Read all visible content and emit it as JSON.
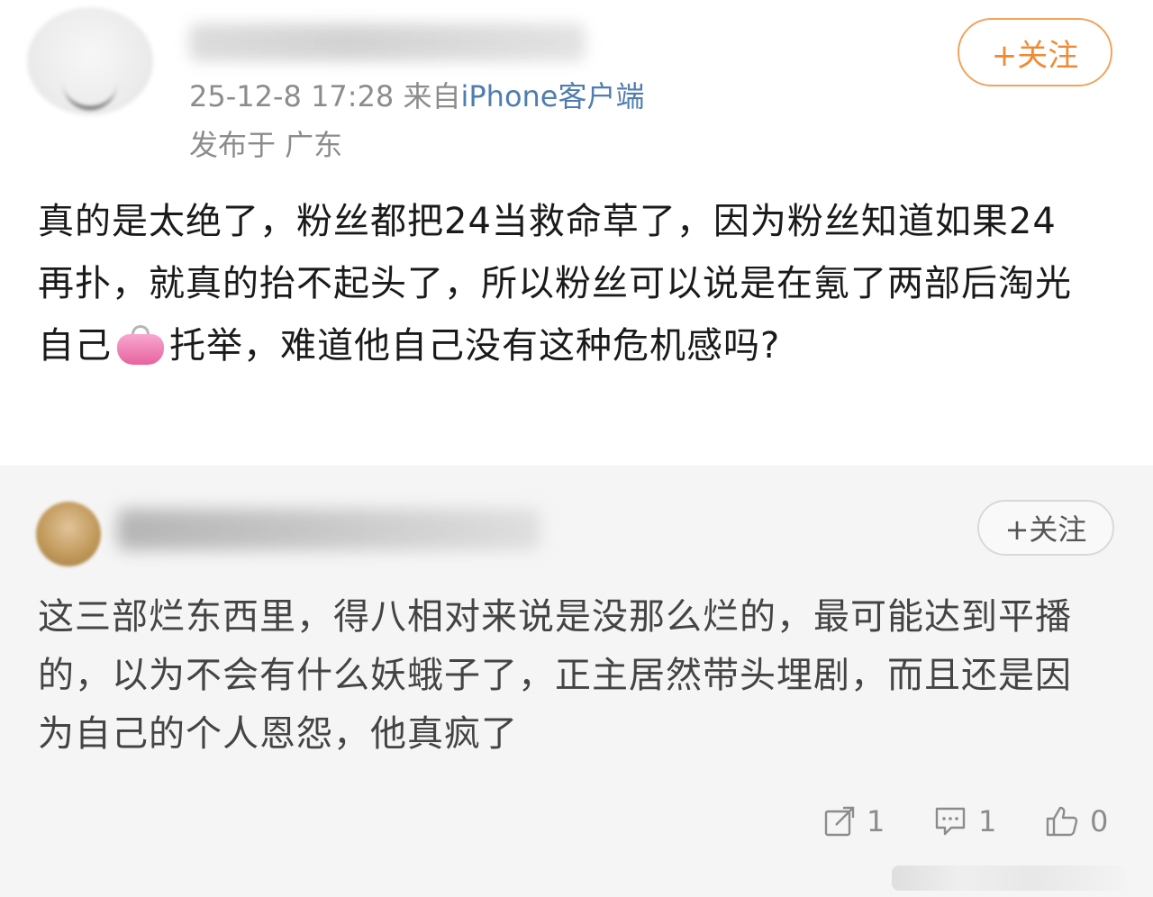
{
  "post": {
    "meta_time": "25-12-8 17:28",
    "meta_from": "来自",
    "meta_source": "iPhone客户端",
    "location": "发布于 广东",
    "follow_label": "+关注",
    "text_part1": "真的是太绝了，粉丝都把24当救命草了，因为粉丝知道如果24再扑，就真的抬不起头了，所以粉丝可以说是在氪了两部后淘光自己",
    "emoji": "purse-emoji",
    "text_part2": "托举，难道他自己没有这种危机感吗?"
  },
  "comment": {
    "follow_label": "+关注",
    "text": "这三部烂东西里，得八相对来说是没那么烂的，最可能达到平播的，以为不会有什么妖蛾子了，正主居然带头埋剧，而且还是因为自己的个人恩怨，他真疯了",
    "actions": {
      "share_count": "1",
      "reply_count": "1",
      "like_count": "0"
    }
  },
  "colors": {
    "follow_accent": "#f08a33",
    "source_link": "#507daf",
    "comment_bg": "#f5f5f5"
  }
}
